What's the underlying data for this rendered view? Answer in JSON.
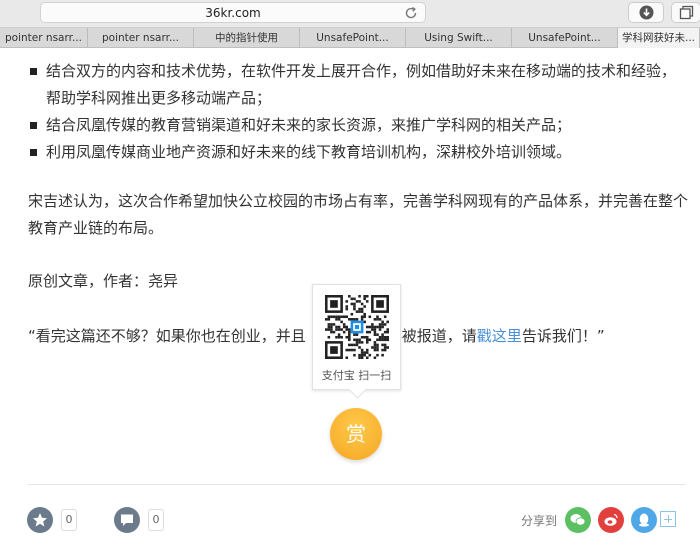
{
  "browser": {
    "url": "36kr.com",
    "tabs": [
      {
        "label": "pointer nsarr...",
        "width": 88
      },
      {
        "label": "pointer nsarr...",
        "width": 106
      },
      {
        "label": "中的指针使用",
        "width": 106
      },
      {
        "label": "UnsafePoint...",
        "width": 106
      },
      {
        "label": "Using Swift...",
        "width": 106
      },
      {
        "label": "UnsafePoint...",
        "width": 106
      },
      {
        "label": "学科网获好未...",
        "width": 82,
        "active": true
      }
    ]
  },
  "article": {
    "bullets": [
      "结合双方的内容和技术优势，在软件开发上展开合作，例如借助好未来在移动端的技术和经验，帮助学科网推出更多移动端产品；",
      "结合凤凰传媒的教育营销渠道和好未来的家长资源，来推广学科网的相关产品；",
      "利用凤凰传媒商业地产资源和好未来的线下教育培训机构，深耕校外培训领域。"
    ],
    "paragraph1": "宋吉述认为，这次合作希望加快公立校园的市场占有率，完善学科网现有的产品体系，并完善在整个教育产业链的布局。",
    "paragraph2": "原创文章，作者：尧异",
    "quote_part1": "“看完这篇还不够？如果你也在创业，并且",
    "quote_part2": "项目被报道，请",
    "quote_link": "戳这里",
    "quote_part3": "告诉我们！”"
  },
  "reward": {
    "qr_caption": "支付宝 扫一扫",
    "button_label": "赏"
  },
  "footer": {
    "like_count": "0",
    "comment_count": "0",
    "share_label": "分享到"
  }
}
